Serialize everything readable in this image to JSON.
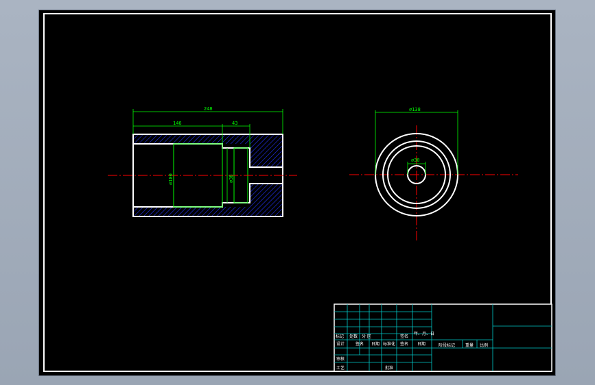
{
  "drawing": {
    "dimensions": {
      "total_length": "248",
      "bore_depth": "146",
      "step_length": "43",
      "bore_diameter": "⌀100",
      "step_diameter": "⌀38",
      "outer_diameter": "⌀138",
      "inner_diameter": "⌀30"
    },
    "title_block": {
      "mark": "标记",
      "count": "处数",
      "zone": "分 区",
      "sign": "签名",
      "date_ymd": "年、月、日",
      "design": "设计",
      "signature": "签名",
      "date": "日期",
      "standardization": "标准化",
      "signature2": "签名",
      "date2": "日期",
      "stage_mark": "阶段标记",
      "weight": "重量",
      "scale": "比例",
      "review": "审核",
      "process": "工艺",
      "approve": "批准"
    }
  },
  "colors": {
    "background": "#000000",
    "outline": "#ffffff",
    "dimension": "#00ff00",
    "centerline": "#ff0000",
    "hatch": "#2233ff",
    "title_grid": "#00c8c8"
  }
}
